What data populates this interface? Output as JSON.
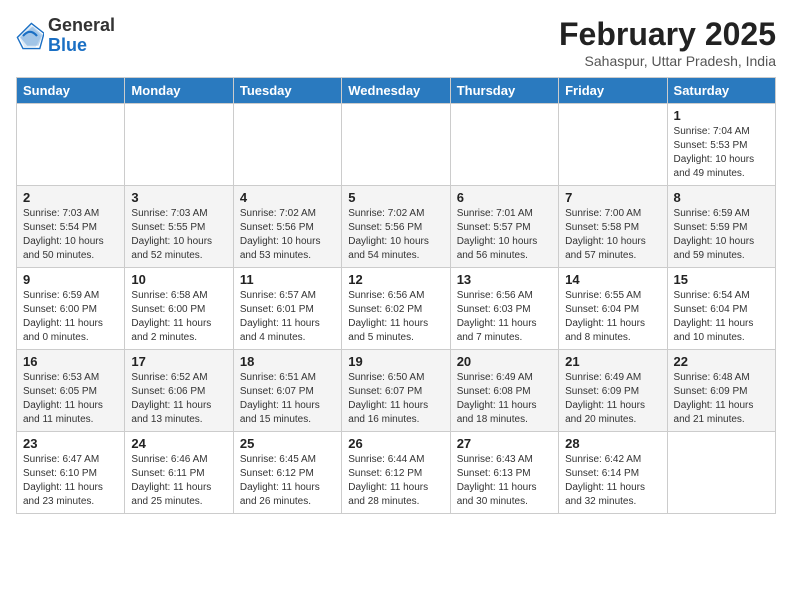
{
  "header": {
    "logo_general": "General",
    "logo_blue": "Blue",
    "month_title": "February 2025",
    "location": "Sahaspur, Uttar Pradesh, India"
  },
  "weekdays": [
    "Sunday",
    "Monday",
    "Tuesday",
    "Wednesday",
    "Thursday",
    "Friday",
    "Saturday"
  ],
  "weeks": [
    [
      {
        "day": "",
        "info": ""
      },
      {
        "day": "",
        "info": ""
      },
      {
        "day": "",
        "info": ""
      },
      {
        "day": "",
        "info": ""
      },
      {
        "day": "",
        "info": ""
      },
      {
        "day": "",
        "info": ""
      },
      {
        "day": "1",
        "info": "Sunrise: 7:04 AM\nSunset: 5:53 PM\nDaylight: 10 hours and 49 minutes."
      }
    ],
    [
      {
        "day": "2",
        "info": "Sunrise: 7:03 AM\nSunset: 5:54 PM\nDaylight: 10 hours and 50 minutes."
      },
      {
        "day": "3",
        "info": "Sunrise: 7:03 AM\nSunset: 5:55 PM\nDaylight: 10 hours and 52 minutes."
      },
      {
        "day": "4",
        "info": "Sunrise: 7:02 AM\nSunset: 5:56 PM\nDaylight: 10 hours and 53 minutes."
      },
      {
        "day": "5",
        "info": "Sunrise: 7:02 AM\nSunset: 5:56 PM\nDaylight: 10 hours and 54 minutes."
      },
      {
        "day": "6",
        "info": "Sunrise: 7:01 AM\nSunset: 5:57 PM\nDaylight: 10 hours and 56 minutes."
      },
      {
        "day": "7",
        "info": "Sunrise: 7:00 AM\nSunset: 5:58 PM\nDaylight: 10 hours and 57 minutes."
      },
      {
        "day": "8",
        "info": "Sunrise: 6:59 AM\nSunset: 5:59 PM\nDaylight: 10 hours and 59 minutes."
      }
    ],
    [
      {
        "day": "9",
        "info": "Sunrise: 6:59 AM\nSunset: 6:00 PM\nDaylight: 11 hours and 0 minutes."
      },
      {
        "day": "10",
        "info": "Sunrise: 6:58 AM\nSunset: 6:00 PM\nDaylight: 11 hours and 2 minutes."
      },
      {
        "day": "11",
        "info": "Sunrise: 6:57 AM\nSunset: 6:01 PM\nDaylight: 11 hours and 4 minutes."
      },
      {
        "day": "12",
        "info": "Sunrise: 6:56 AM\nSunset: 6:02 PM\nDaylight: 11 hours and 5 minutes."
      },
      {
        "day": "13",
        "info": "Sunrise: 6:56 AM\nSunset: 6:03 PM\nDaylight: 11 hours and 7 minutes."
      },
      {
        "day": "14",
        "info": "Sunrise: 6:55 AM\nSunset: 6:04 PM\nDaylight: 11 hours and 8 minutes."
      },
      {
        "day": "15",
        "info": "Sunrise: 6:54 AM\nSunset: 6:04 PM\nDaylight: 11 hours and 10 minutes."
      }
    ],
    [
      {
        "day": "16",
        "info": "Sunrise: 6:53 AM\nSunset: 6:05 PM\nDaylight: 11 hours and 11 minutes."
      },
      {
        "day": "17",
        "info": "Sunrise: 6:52 AM\nSunset: 6:06 PM\nDaylight: 11 hours and 13 minutes."
      },
      {
        "day": "18",
        "info": "Sunrise: 6:51 AM\nSunset: 6:07 PM\nDaylight: 11 hours and 15 minutes."
      },
      {
        "day": "19",
        "info": "Sunrise: 6:50 AM\nSunset: 6:07 PM\nDaylight: 11 hours and 16 minutes."
      },
      {
        "day": "20",
        "info": "Sunrise: 6:49 AM\nSunset: 6:08 PM\nDaylight: 11 hours and 18 minutes."
      },
      {
        "day": "21",
        "info": "Sunrise: 6:49 AM\nSunset: 6:09 PM\nDaylight: 11 hours and 20 minutes."
      },
      {
        "day": "22",
        "info": "Sunrise: 6:48 AM\nSunset: 6:09 PM\nDaylight: 11 hours and 21 minutes."
      }
    ],
    [
      {
        "day": "23",
        "info": "Sunrise: 6:47 AM\nSunset: 6:10 PM\nDaylight: 11 hours and 23 minutes."
      },
      {
        "day": "24",
        "info": "Sunrise: 6:46 AM\nSunset: 6:11 PM\nDaylight: 11 hours and 25 minutes."
      },
      {
        "day": "25",
        "info": "Sunrise: 6:45 AM\nSunset: 6:12 PM\nDaylight: 11 hours and 26 minutes."
      },
      {
        "day": "26",
        "info": "Sunrise: 6:44 AM\nSunset: 6:12 PM\nDaylight: 11 hours and 28 minutes."
      },
      {
        "day": "27",
        "info": "Sunrise: 6:43 AM\nSunset: 6:13 PM\nDaylight: 11 hours and 30 minutes."
      },
      {
        "day": "28",
        "info": "Sunrise: 6:42 AM\nSunset: 6:14 PM\nDaylight: 11 hours and 32 minutes."
      },
      {
        "day": "",
        "info": ""
      }
    ]
  ]
}
